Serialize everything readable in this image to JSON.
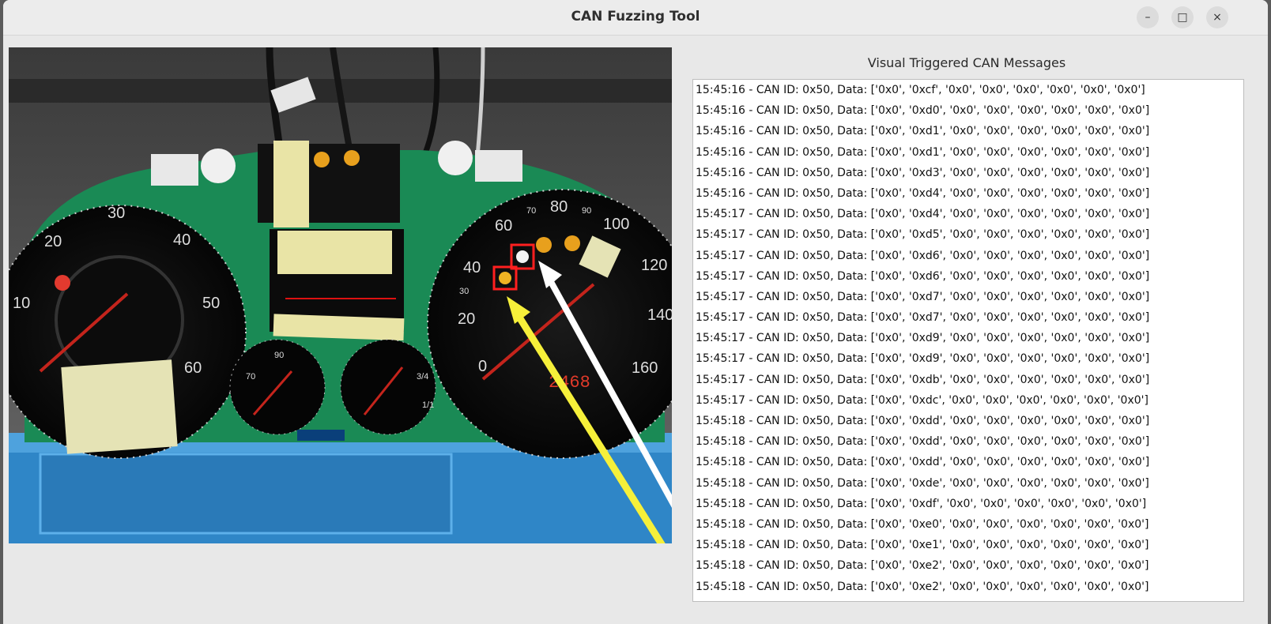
{
  "window": {
    "title": "CAN Fuzzing Tool",
    "controls": {
      "minimize": "–",
      "maximize": "□",
      "close": "×"
    }
  },
  "camera": {
    "gauges": {
      "left_ticks": [
        "10",
        "20",
        "30",
        "40",
        "50",
        "60"
      ],
      "right_ticks": [
        "0",
        "20",
        "30",
        "40",
        "60",
        "70",
        "80",
        "90",
        "100",
        "120",
        "140",
        "160"
      ],
      "center_ticks": [
        "70",
        "90",
        "3/4",
        "1/1"
      ],
      "odometer": "2468"
    },
    "colors": {
      "warning_highlight": "#ff1f1f",
      "arrow_yellow": "#f6f03a",
      "arrow_white": "#ffffff",
      "pcb_green": "#1a8a55",
      "tray_blue": "#2e86c9"
    }
  },
  "log": {
    "title": "Visual Triggered CAN Messages",
    "lines": [
      "15:45:16 - CAN ID: 0x50, Data: ['0x0', '0xcf', '0x0', '0x0', '0x0', '0x0', '0x0', '0x0']",
      "15:45:16 - CAN ID: 0x50, Data: ['0x0', '0xd0', '0x0', '0x0', '0x0', '0x0', '0x0', '0x0']",
      "15:45:16 - CAN ID: 0x50, Data: ['0x0', '0xd1', '0x0', '0x0', '0x0', '0x0', '0x0', '0x0']",
      "15:45:16 - CAN ID: 0x50, Data: ['0x0', '0xd1', '0x0', '0x0', '0x0', '0x0', '0x0', '0x0']",
      "15:45:16 - CAN ID: 0x50, Data: ['0x0', '0xd3', '0x0', '0x0', '0x0', '0x0', '0x0', '0x0']",
      "15:45:16 - CAN ID: 0x50, Data: ['0x0', '0xd4', '0x0', '0x0', '0x0', '0x0', '0x0', '0x0']",
      "15:45:17 - CAN ID: 0x50, Data: ['0x0', '0xd4', '0x0', '0x0', '0x0', '0x0', '0x0', '0x0']",
      "15:45:17 - CAN ID: 0x50, Data: ['0x0', '0xd5', '0x0', '0x0', '0x0', '0x0', '0x0', '0x0']",
      "15:45:17 - CAN ID: 0x50, Data: ['0x0', '0xd6', '0x0', '0x0', '0x0', '0x0', '0x0', '0x0']",
      "15:45:17 - CAN ID: 0x50, Data: ['0x0', '0xd6', '0x0', '0x0', '0x0', '0x0', '0x0', '0x0']",
      "15:45:17 - CAN ID: 0x50, Data: ['0x0', '0xd7', '0x0', '0x0', '0x0', '0x0', '0x0', '0x0']",
      "15:45:17 - CAN ID: 0x50, Data: ['0x0', '0xd7', '0x0', '0x0', '0x0', '0x0', '0x0', '0x0']",
      "15:45:17 - CAN ID: 0x50, Data: ['0x0', '0xd9', '0x0', '0x0', '0x0', '0x0', '0x0', '0x0']",
      "15:45:17 - CAN ID: 0x50, Data: ['0x0', '0xd9', '0x0', '0x0', '0x0', '0x0', '0x0', '0x0']",
      "15:45:17 - CAN ID: 0x50, Data: ['0x0', '0xdb', '0x0', '0x0', '0x0', '0x0', '0x0', '0x0']",
      "15:45:17 - CAN ID: 0x50, Data: ['0x0', '0xdc', '0x0', '0x0', '0x0', '0x0', '0x0', '0x0']",
      "15:45:18 - CAN ID: 0x50, Data: ['0x0', '0xdd', '0x0', '0x0', '0x0', '0x0', '0x0', '0x0']",
      "15:45:18 - CAN ID: 0x50, Data: ['0x0', '0xdd', '0x0', '0x0', '0x0', '0x0', '0x0', '0x0']",
      "15:45:18 - CAN ID: 0x50, Data: ['0x0', '0xdd', '0x0', '0x0', '0x0', '0x0', '0x0', '0x0']",
      "15:45:18 - CAN ID: 0x50, Data: ['0x0', '0xde', '0x0', '0x0', '0x0', '0x0', '0x0', '0x0']",
      "15:45:18 - CAN ID: 0x50, Data: ['0x0', '0xdf', '0x0', '0x0', '0x0', '0x0', '0x0', '0x0']",
      "15:45:18 - CAN ID: 0x50, Data: ['0x0', '0xe0', '0x0', '0x0', '0x0', '0x0', '0x0', '0x0']",
      "15:45:18 - CAN ID: 0x50, Data: ['0x0', '0xe1', '0x0', '0x0', '0x0', '0x0', '0x0', '0x0']",
      "15:45:18 - CAN ID: 0x50, Data: ['0x0', '0xe2', '0x0', '0x0', '0x0', '0x0', '0x0', '0x0']",
      "15:45:18 - CAN ID: 0x50, Data: ['0x0', '0xe2', '0x0', '0x0', '0x0', '0x0', '0x0', '0x0']"
    ]
  }
}
